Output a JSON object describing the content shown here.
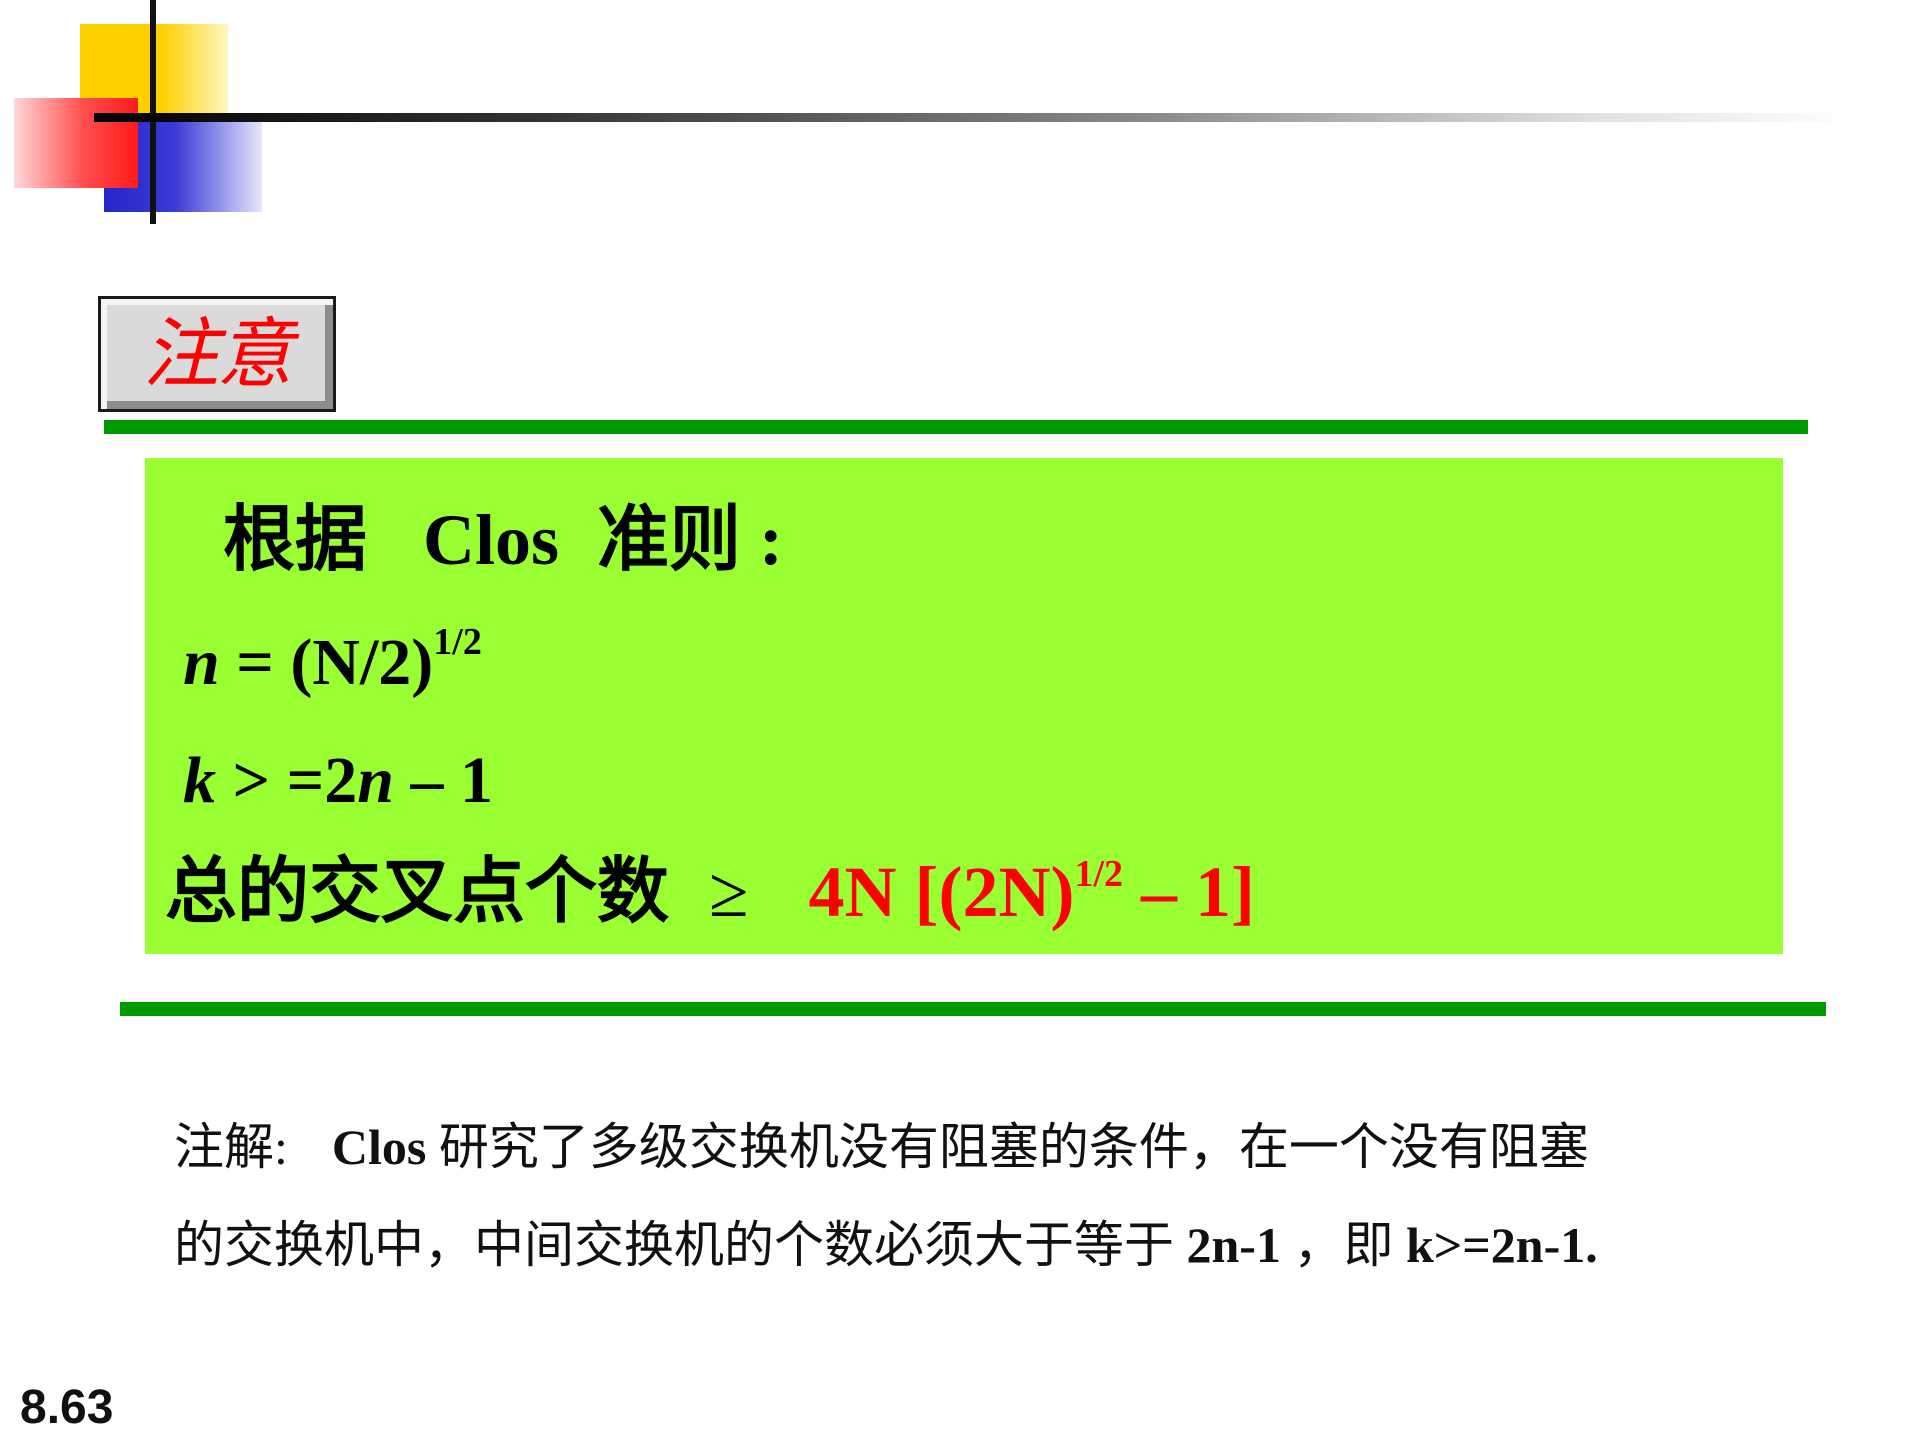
{
  "badge": {
    "text": "注意"
  },
  "formula": {
    "title_prefix": "根据",
    "title_name": "Clos",
    "title_suffix": "准则 :",
    "n_var": "n",
    "n_expr": " = (N/2)",
    "n_exp": "1/2",
    "k_var": "k",
    "k_expr1": " > =2",
    "k_var2": "n",
    "k_expr2": " – 1",
    "total_label": "总的交叉点个数",
    "total_symbol": "≥",
    "total_expr_pre": "4N [(2N)",
    "total_expr_exp": "1/2",
    "total_expr_post": " – 1]"
  },
  "note": {
    "label": "注解:",
    "line1_a": "Clos",
    "line1_b": " 研究了多级交换机没有阻塞的条件，在一个没有阻塞",
    "line2_a": "的交换机中，中间交换机的个数必须大于等于 ",
    "line2_b": "2n-1",
    "line2_c": " ，即 ",
    "line2_d": "k>=2n-1."
  },
  "page_number": "8.63",
  "colors": {
    "highlight_box": "#99ff33",
    "rule_green": "#009a00",
    "accent_red": "#ff0000"
  }
}
